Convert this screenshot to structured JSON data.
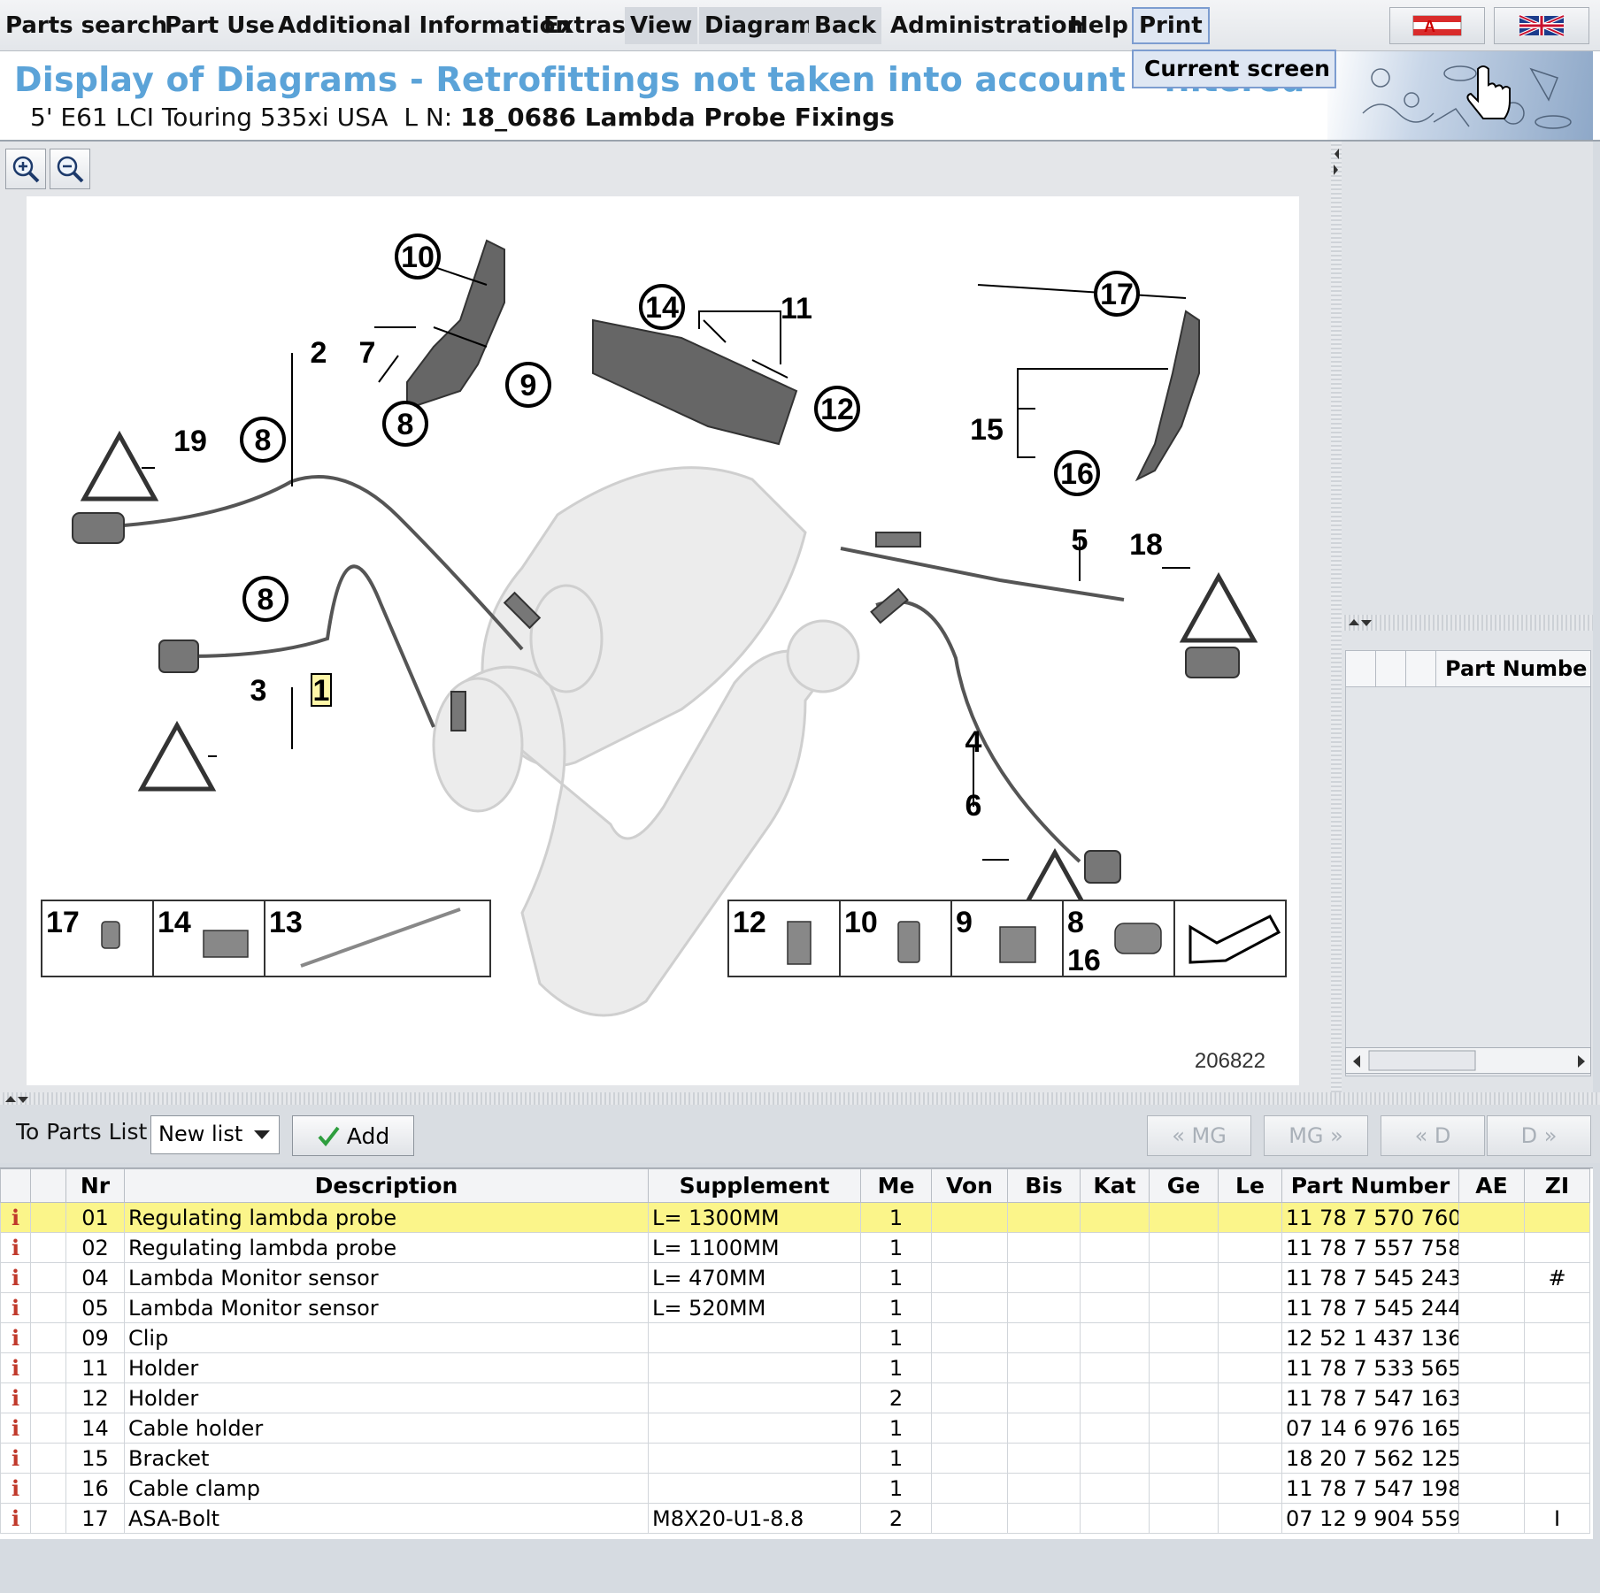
{
  "menu": {
    "items": [
      "Parts search",
      "Part Use",
      "Additional Information",
      "Extras",
      "View",
      "Diagram",
      "Back",
      "Administration",
      "Help",
      "Print"
    ],
    "print_dropdown": "Current screen"
  },
  "header": {
    "title": "Display of Diagrams - Retrofittings not taken into account - filtered",
    "model": "5' E61 LCI Touring 535xi USA",
    "ln_label": "L N:",
    "diagram_name": "18_0686 Lambda Probe Fixings"
  },
  "diagram": {
    "image_number": "206822",
    "callouts": [
      "10",
      "14",
      "11",
      "17",
      "2",
      "7",
      "9",
      "12",
      "8",
      "19",
      "8",
      "15",
      "16",
      "5",
      "18",
      "8",
      "3",
      "1",
      "4",
      "6"
    ],
    "legend_left": [
      "17",
      "14",
      "13"
    ],
    "legend_right": [
      "12",
      "10",
      "9",
      "8",
      "16"
    ]
  },
  "right_panel": {
    "column_header": "Part Numbe"
  },
  "toolbar": {
    "to_parts_list": "To Parts List",
    "list_select": "New list",
    "add": "Add",
    "nav": [
      "« MG",
      "MG »",
      "« D",
      "D »"
    ]
  },
  "table": {
    "columns": [
      "",
      "",
      "Nr",
      "Description",
      "Supplement",
      "Me",
      "Von",
      "Bis",
      "Kat",
      "Ge",
      "Le",
      "Part Number",
      "AE",
      "ZI"
    ],
    "rows": [
      {
        "nr": "01",
        "desc": "Regulating lambda probe",
        "supp": "L= 1300MM",
        "me": "1",
        "pn": "11 78 7 570 760",
        "zi": ""
      },
      {
        "nr": "02",
        "desc": "Regulating lambda probe",
        "supp": "L= 1100MM",
        "me": "1",
        "pn": "11 78 7 557 758",
        "zi": ""
      },
      {
        "nr": "04",
        "desc": "Lambda Monitor sensor",
        "supp": "L= 470MM",
        "me": "1",
        "pn": "11 78 7 545 243",
        "zi": "#"
      },
      {
        "nr": "05",
        "desc": "Lambda Monitor sensor",
        "supp": "L= 520MM",
        "me": "1",
        "pn": "11 78 7 545 244",
        "zi": ""
      },
      {
        "nr": "09",
        "desc": "Clip",
        "supp": "",
        "me": "1",
        "pn": "12 52 1 437 136",
        "zi": ""
      },
      {
        "nr": "11",
        "desc": "Holder",
        "supp": "",
        "me": "1",
        "pn": "11 78 7 533 565",
        "zi": ""
      },
      {
        "nr": "12",
        "desc": "Holder",
        "supp": "",
        "me": "2",
        "pn": "11 78 7 547 163",
        "zi": ""
      },
      {
        "nr": "14",
        "desc": "Cable holder",
        "supp": "",
        "me": "1",
        "pn": "07 14 6 976 165",
        "zi": ""
      },
      {
        "nr": "15",
        "desc": "Bracket",
        "supp": "",
        "me": "1",
        "pn": "18 20 7 562 125",
        "zi": ""
      },
      {
        "nr": "16",
        "desc": "Cable clamp",
        "supp": "",
        "me": "1",
        "pn": "11 78 7 547 198",
        "zi": ""
      },
      {
        "nr": "17",
        "desc": "ASA-Bolt",
        "supp": "M8X20-U1-8.8",
        "me": "2",
        "pn": "07 12 9 904 559",
        "zi": "I"
      }
    ],
    "selected_index": 0
  }
}
